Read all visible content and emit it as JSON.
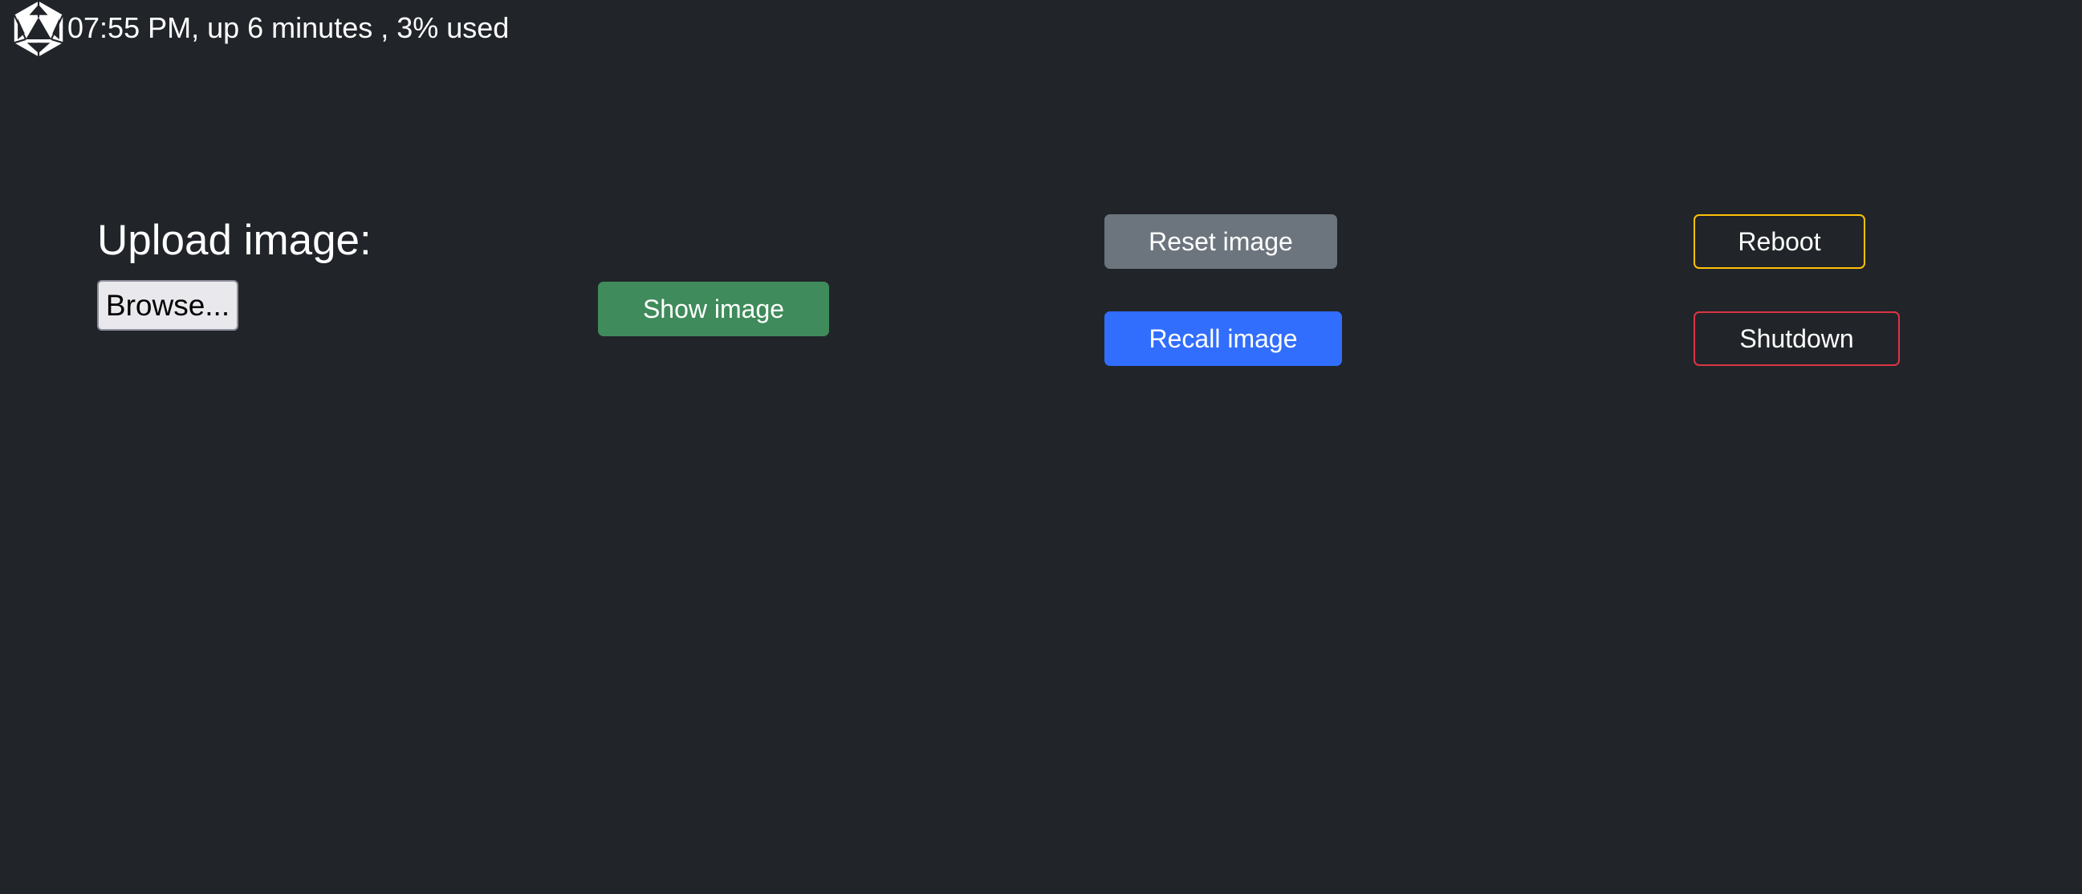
{
  "status": {
    "logo_icon": "d20-icosahedron-icon",
    "text": "07:55 PM, up 6 minutes , 3% used"
  },
  "upload": {
    "title": "Upload image:",
    "browse_label": "Browse..."
  },
  "buttons": {
    "show_image": "Show image",
    "reset_image": "Reset image",
    "recall_image": "Recall image",
    "reboot": "Reboot",
    "shutdown": "Shutdown"
  },
  "colors": {
    "background": "#212529",
    "success": "#3f8b5b",
    "secondary": "#6c757d",
    "primary": "#316efd",
    "warning": "#ffc107",
    "danger": "#dc3545"
  }
}
